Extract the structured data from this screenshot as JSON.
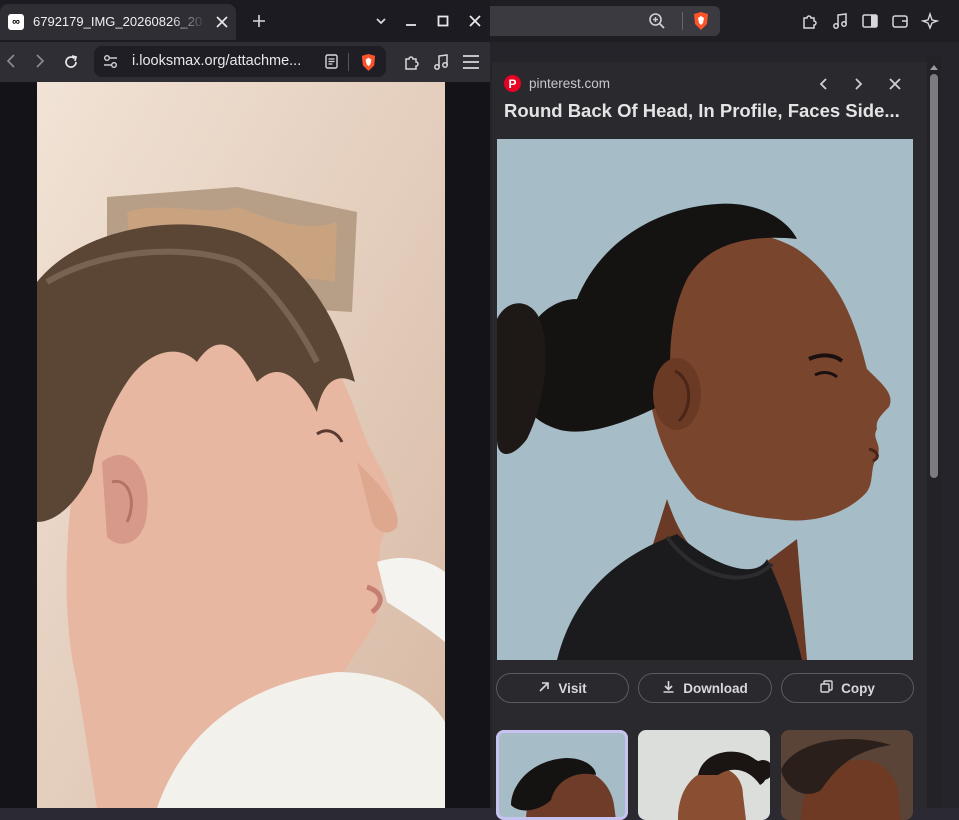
{
  "background_browser": {
    "toolbar_icons": [
      "zoom-icon",
      "brave-shield-icon",
      "extensions-icon",
      "media-icon",
      "sidebar-icon",
      "wallet-icon",
      "leo-ai-icon"
    ]
  },
  "lens_panel": {
    "source_domain": "pinterest.com",
    "source_logo_letter": "P",
    "title": "Round Back Of Head, In Profile, Faces Side...",
    "buttons": {
      "visit": "Visit",
      "download": "Download",
      "copy": "Copy"
    },
    "thumbnails_count": 3
  },
  "foreground_browser": {
    "tab_title": "6792179_IMG_20260826_20",
    "favicon_text": "∞",
    "url": "i.looksmax.org/attachme..."
  },
  "colors": {
    "accent_selected": "#c7c2f0",
    "pinterest": "#e60023",
    "brave": "#fb542b"
  }
}
